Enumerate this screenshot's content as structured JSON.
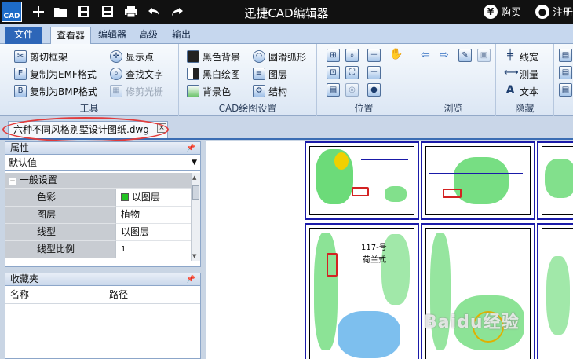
{
  "app": {
    "logo_text": "CAD",
    "title": "迅捷CAD编辑器",
    "buy_label": "购买",
    "register_label": "注册"
  },
  "ribbon_tabs": [
    "文件",
    "查看器",
    "编辑器",
    "高级",
    "输出"
  ],
  "ribbon": {
    "tools": {
      "label": "工具",
      "buttons": [
        "剪切框架",
        "复制为EMF格式",
        "复制为BMP格式",
        "显示点",
        "查找文字",
        "修剪光栅"
      ]
    },
    "cad_settings": {
      "label": "CAD绘图设置",
      "buttons": [
        "黑色背景",
        "黑白绘图",
        "背景色",
        "圆滑弧形",
        "图层",
        "结构"
      ]
    },
    "position": {
      "label": "位置"
    },
    "browse": {
      "label": "浏览"
    },
    "hidden": {
      "label": "隐藏",
      "buttons": [
        "线宽",
        "测量",
        "文本"
      ]
    }
  },
  "document": {
    "tab_label": "六种不同风格别墅设计图纸.dwg",
    "close_glyph": "×"
  },
  "properties_panel": {
    "title": "属性",
    "dropdown_value": "默认值",
    "section": "一般设置",
    "rows": [
      {
        "name": "色彩",
        "value": "以图层",
        "swatch": "#22c322"
      },
      {
        "name": "图层",
        "value": "植物"
      },
      {
        "name": "线型",
        "value": "以图层"
      },
      {
        "name": "线型比例",
        "value": "1"
      }
    ]
  },
  "favorites_panel": {
    "title": "收藏夹",
    "columns": [
      "名称",
      "路径"
    ]
  },
  "drawing": {
    "label_1": "117-号",
    "label_2": "荷兰式",
    "watermark": "Baidu经验"
  },
  "colors": {
    "titlebar": "#111111",
    "file_tab": "#2d66b8",
    "cad_green": "#22c322",
    "cad_blue": "#1a1aa8",
    "cad_red": "#d32222",
    "annotation_red": "#e23c3c"
  }
}
